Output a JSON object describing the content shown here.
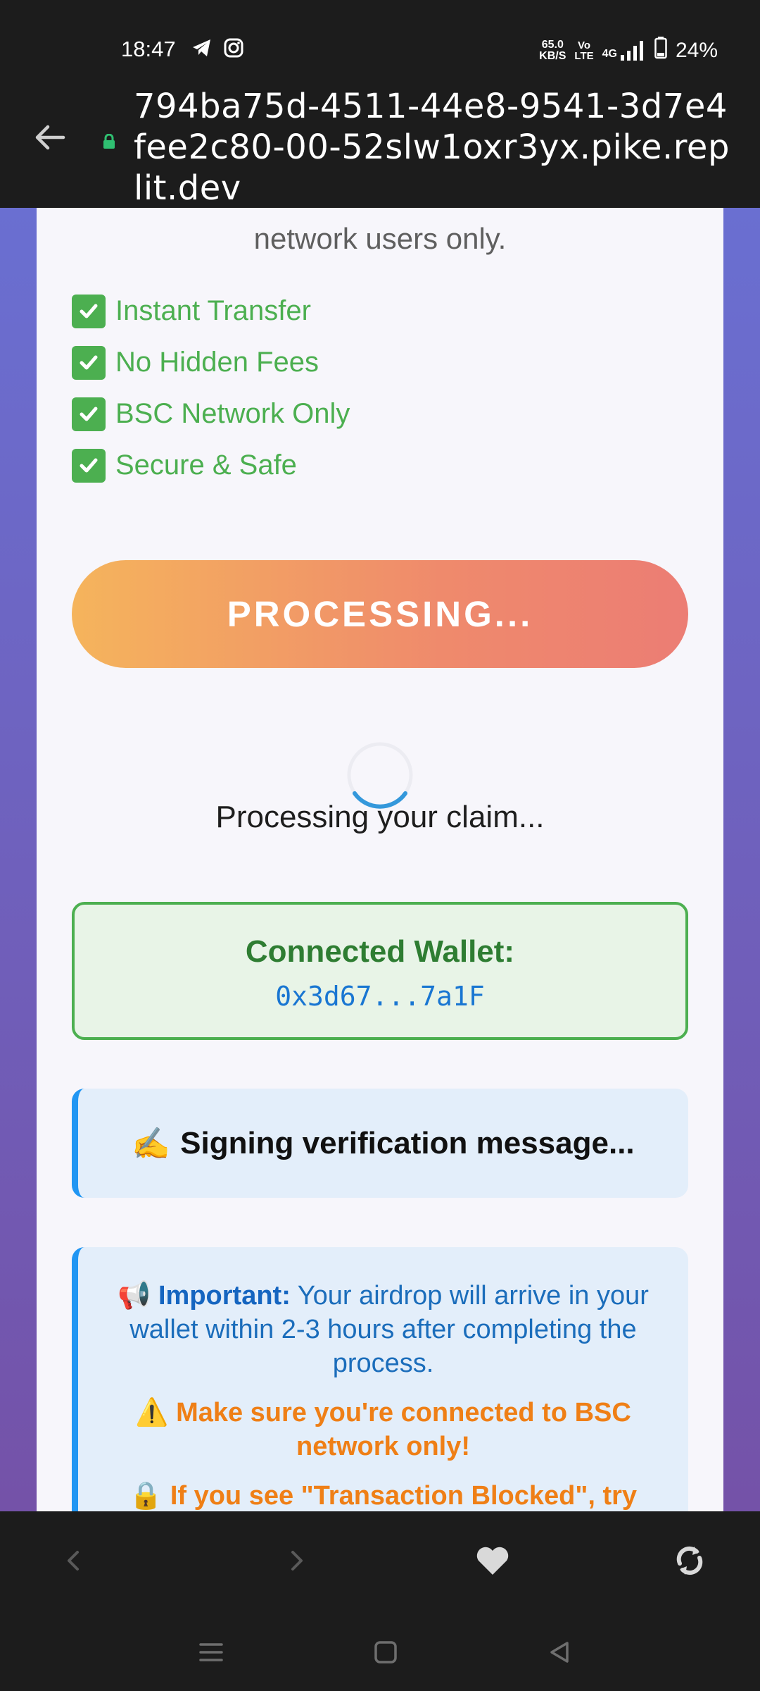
{
  "status_bar": {
    "time": "18:47",
    "net_speed_value": "65.0",
    "net_speed_unit": "KB/S",
    "volte_top": "Vo",
    "volte_bottom": "LTE",
    "network": "4G",
    "battery": "24%",
    "icons": [
      "telegram-icon",
      "instagram-icon",
      "signal-icon",
      "battery-icon"
    ]
  },
  "url_bar": {
    "url": "794ba75d-4511-44e8-9541-3d7e4fee2c80-00-52slw1oxr3yx.pike.replit.dev",
    "icons": [
      "back-arrow-icon",
      "lock-icon"
    ]
  },
  "page": {
    "intro_text": "network users only.",
    "features": [
      "Instant Transfer",
      "No Hidden Fees",
      "BSC Network Only",
      "Secure & Safe"
    ],
    "process_button": "PROCESSING...",
    "processing_text": "Processing your claim...",
    "wallet": {
      "label": "Connected Wallet:",
      "address": "0x3d67...7a1F"
    },
    "signing": {
      "emoji": "✍️",
      "text": "Signing verification message..."
    },
    "important": {
      "emoji": "📢",
      "label": "Important:",
      "text": "Your airdrop will arrive in your wallet within 2-3 hours after completing the process.",
      "warning_emoji": "⚠️",
      "warning": "Make sure you're connected to BSC network only!",
      "blocked_emoji": "🔒",
      "blocked": "If you see \"Transaction Blocked\", try"
    }
  },
  "colors": {
    "accent_green": "#4caf50",
    "accent_blue": "#2196f3",
    "button_gradient_start": "#f5b45c",
    "button_gradient_end": "#ec7d74",
    "background_gradient_start": "#6a6fd1",
    "background_gradient_end": "#7452a8"
  },
  "browser_nav": {
    "icons": [
      "back-icon",
      "forward-icon",
      "favorite-heart-icon",
      "refresh-icon"
    ]
  },
  "system_nav": {
    "icons": [
      "menu-icon",
      "home-icon",
      "back-triangle-icon"
    ]
  }
}
